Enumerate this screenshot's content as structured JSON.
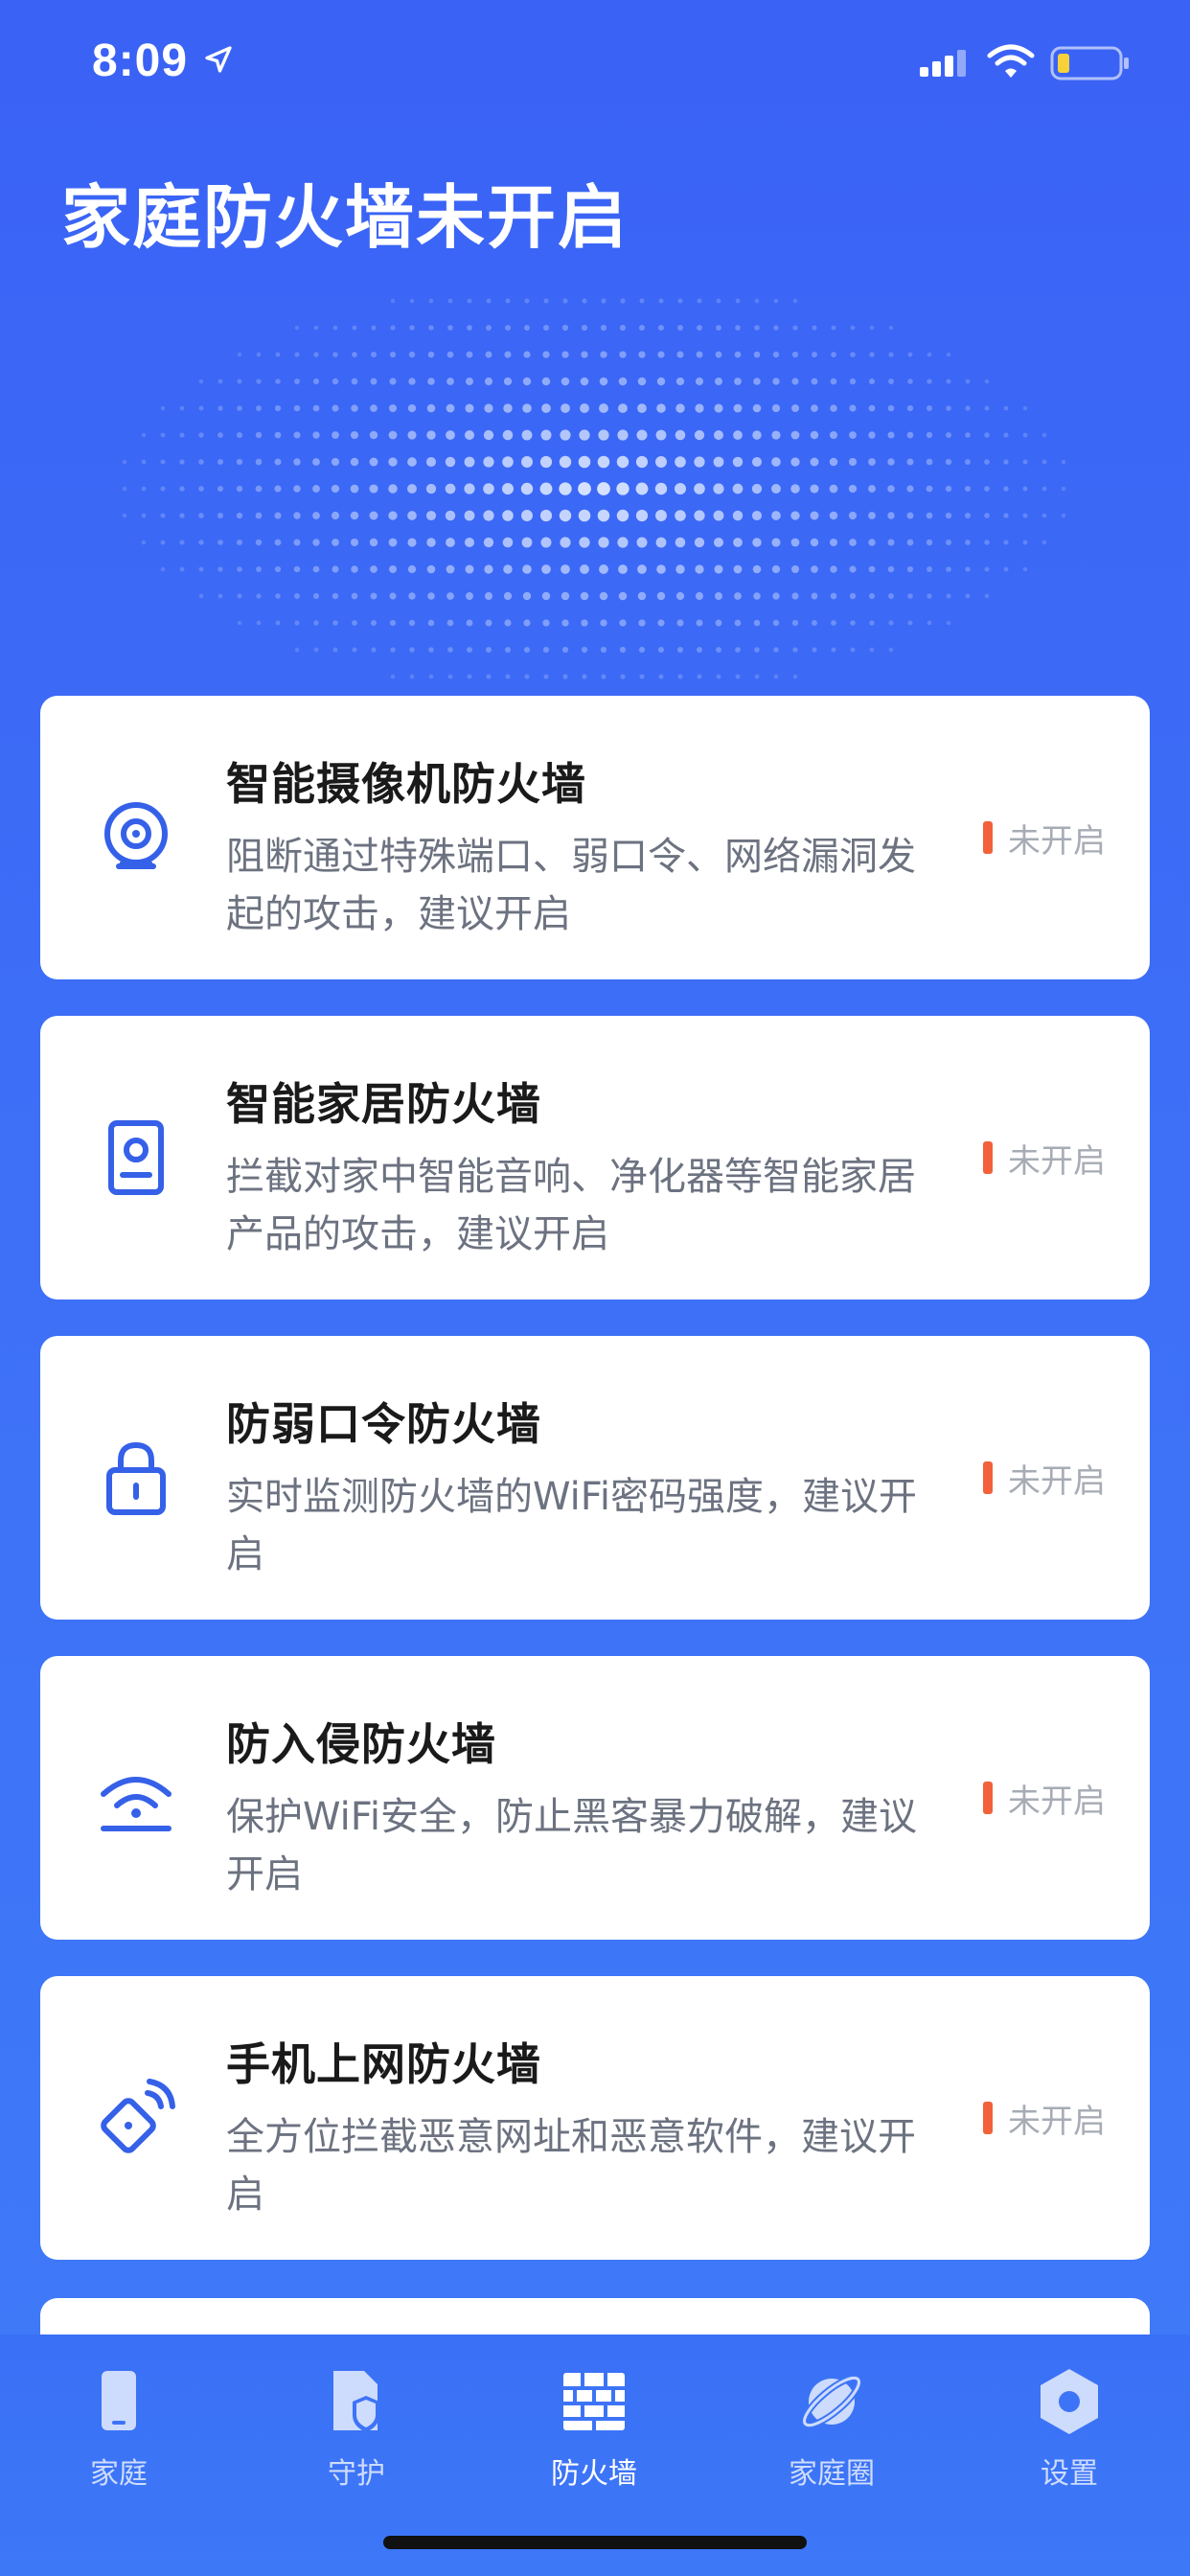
{
  "status_bar": {
    "time": "8:09",
    "icons": [
      "location-arrow-icon",
      "cellular-signal-icon",
      "wifi-icon",
      "battery-low-icon"
    ]
  },
  "header": {
    "title": "家庭防火墙未开启"
  },
  "colors": {
    "background": "#3d6ef7",
    "card": "#ffffff",
    "accent_icon": "#3560e8",
    "status_bar_mark": "#f2613a",
    "status_text": "#a6abb5"
  },
  "cards": [
    {
      "icon": "camera-icon",
      "title": "智能摄像机防火墙",
      "desc": "阻断通过特殊端口、弱口令、网络漏洞发起的攻击，建议开启",
      "status": "未开启"
    },
    {
      "icon": "smart-speaker-icon",
      "title": "智能家居防火墙",
      "desc": "拦截对家中智能音响、净化器等智能家居产品的攻击，建议开启",
      "status": "未开启"
    },
    {
      "icon": "lock-icon",
      "title": "防弱口令防火墙",
      "desc": "实时监测防火墙的WiFi密码强度，建议开启",
      "status": "未开启"
    },
    {
      "icon": "router-signal-icon",
      "title": "防入侵防火墙",
      "desc": "保护WiFi安全，防止黑客暴力破解，建议开启",
      "status": "未开启"
    },
    {
      "icon": "phone-network-icon",
      "title": "手机上网防火墙",
      "desc": "全方位拦截恶意网址和恶意软件，建议开启",
      "status": "未开启"
    }
  ],
  "tab_bar": {
    "active": "防火墙",
    "tabs": [
      {
        "label": "家庭",
        "icon": "phone-device-icon"
      },
      {
        "label": "守护",
        "icon": "document-shield-icon"
      },
      {
        "label": "防火墙",
        "icon": "firewall-brick-icon"
      },
      {
        "label": "家庭圈",
        "icon": "planet-icon"
      },
      {
        "label": "设置",
        "icon": "hexagon-gear-icon"
      }
    ]
  }
}
